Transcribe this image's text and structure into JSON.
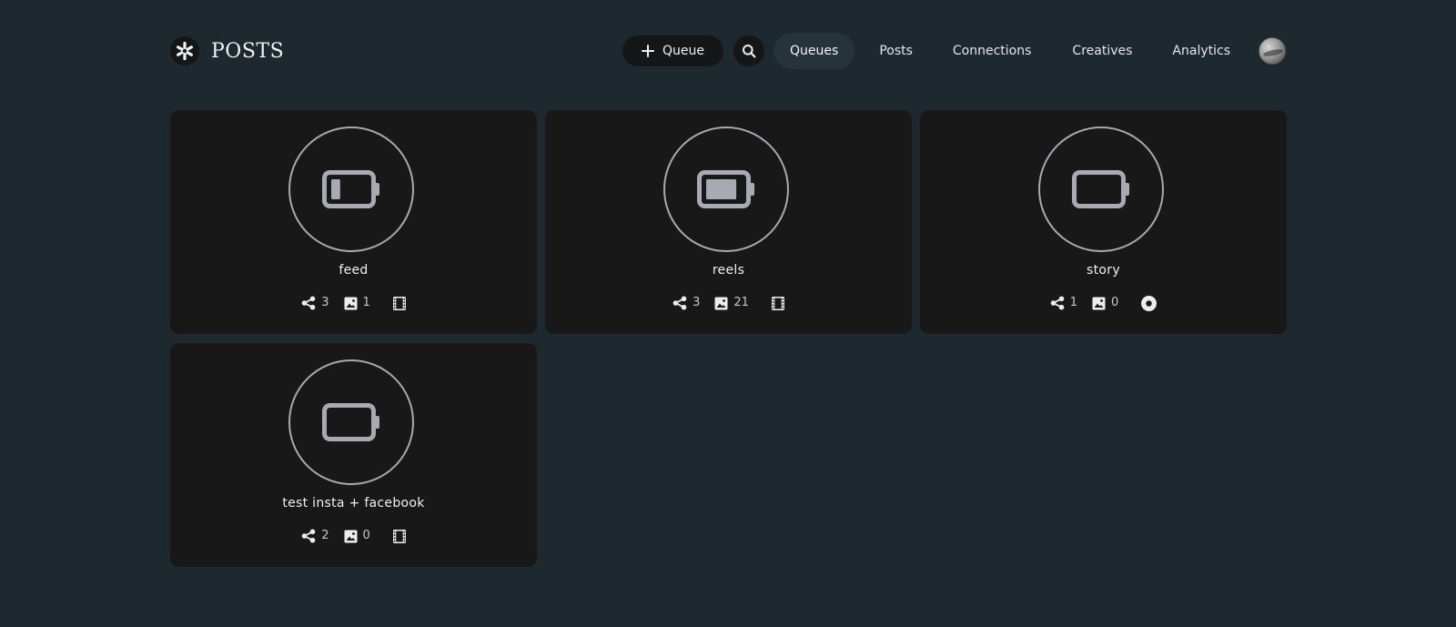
{
  "header": {
    "brand": "POSTS",
    "add_queue_label": "Queue",
    "nav": [
      "Queues",
      "Posts",
      "Connections",
      "Creatives",
      "Analytics"
    ],
    "active_nav": "Queues"
  },
  "colors": {
    "background": "#1d282f",
    "card": "#181818",
    "icon_gray": "#a7a9b3"
  },
  "queues": [
    {
      "title": "feed",
      "connections": "3",
      "posts": "1",
      "type_icon": "film-icon",
      "battery_level": 0.25
    },
    {
      "title": "reels",
      "connections": "3",
      "posts": "21",
      "type_icon": "film-icon",
      "battery_level": 0.85
    },
    {
      "title": "story",
      "connections": "1",
      "posts": "0",
      "type_icon": "record-icon",
      "battery_level": 0
    },
    {
      "title": "test insta + facebook",
      "connections": "2",
      "posts": "0",
      "type_icon": "film-icon",
      "battery_level": 0
    }
  ]
}
